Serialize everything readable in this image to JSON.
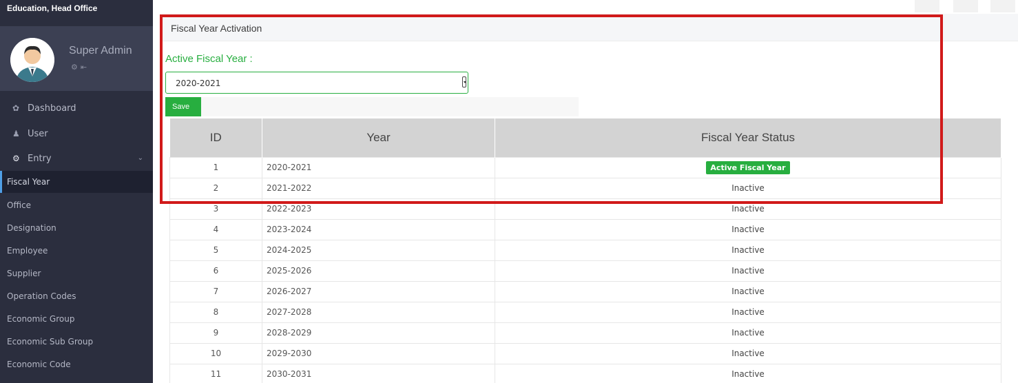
{
  "sidebar": {
    "org_name": "Education, Head Office",
    "user_name": "Super Admin",
    "nav": [
      {
        "label": "Dashboard",
        "icon": "leaf-icon"
      },
      {
        "label": "User",
        "icon": "user-icon"
      },
      {
        "label": "Entry",
        "icon": "gear-icon"
      }
    ],
    "sub_items": [
      {
        "label": "Fiscal Year"
      },
      {
        "label": "Office"
      },
      {
        "label": "Designation"
      },
      {
        "label": "Employee"
      },
      {
        "label": "Supplier"
      },
      {
        "label": "Operation Codes"
      },
      {
        "label": "Economic Group"
      },
      {
        "label": "Economic Sub Group"
      },
      {
        "label": "Economic Code"
      }
    ]
  },
  "main": {
    "panel_title": "Fiscal Year Activation",
    "active_fy_label": "Active Fiscal Year :",
    "select_value": "2020-2021",
    "save_label": "Save",
    "table": {
      "headers": [
        "ID",
        "Year",
        "Fiscal Year Status"
      ],
      "rows": [
        {
          "id": "1",
          "year": "2020-2021",
          "status": "Active Fiscal Year"
        },
        {
          "id": "2",
          "year": "2021-2022",
          "status": "Inactive"
        },
        {
          "id": "3",
          "year": "2022-2023",
          "status": "Inactive"
        },
        {
          "id": "4",
          "year": "2023-2024",
          "status": "Inactive"
        },
        {
          "id": "5",
          "year": "2024-2025",
          "status": "Inactive"
        },
        {
          "id": "6",
          "year": "2025-2026",
          "status": "Inactive"
        },
        {
          "id": "7",
          "year": "2026-2027",
          "status": "Inactive"
        },
        {
          "id": "8",
          "year": "2027-2028",
          "status": "Inactive"
        },
        {
          "id": "9",
          "year": "2028-2029",
          "status": "Inactive"
        },
        {
          "id": "10",
          "year": "2029-2030",
          "status": "Inactive"
        },
        {
          "id": "11",
          "year": "2030-2031",
          "status": "Inactive"
        }
      ]
    }
  },
  "colors": {
    "sidebar_bg": "#2b2e3e",
    "accent_green": "#27ae3f",
    "highlight_red": "#d11a1a"
  }
}
